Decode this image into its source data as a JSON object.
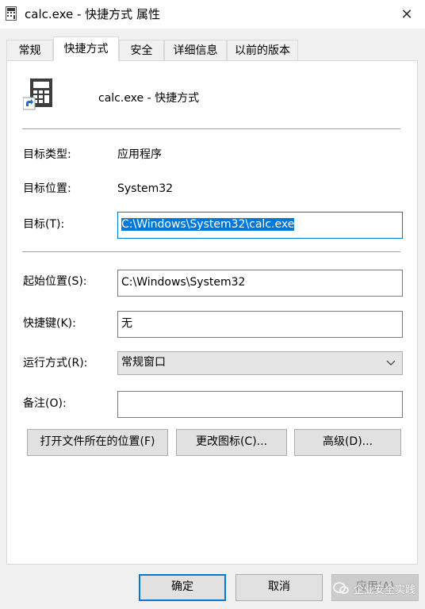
{
  "window": {
    "title": "calc.exe - 快捷方式 属性",
    "close_glyph": "✕"
  },
  "tabs": [
    {
      "label": "常规"
    },
    {
      "label": "快捷方式"
    },
    {
      "label": "安全"
    },
    {
      "label": "详细信息"
    },
    {
      "label": "以前的版本"
    }
  ],
  "shortcut": {
    "name": "calc.exe - 快捷方式",
    "icon": "calculator-shortcut-icon",
    "target_type_label": "目标类型:",
    "target_type_value": "应用程序",
    "target_location_label": "目标位置:",
    "target_location_value": "System32",
    "target_label": "目标(T):",
    "target_value": "C:\\Windows\\System32\\calc.exe",
    "start_in_label": "起始位置(S):",
    "start_in_value": "C:\\Windows\\System32",
    "hotkey_label": "快捷键(K):",
    "hotkey_value": "无",
    "run_label": "运行方式(R):",
    "run_value": "常规窗口",
    "comment_label": "备注(O):",
    "comment_value": ""
  },
  "actions": {
    "open_location": "打开文件所在的位置(F)",
    "change_icon": "更改图标(C)...",
    "advanced": "高级(D)..."
  },
  "footer": {
    "ok": "确定",
    "cancel": "取消",
    "apply": "应用(A)"
  },
  "watermark": {
    "text": "企业安全实践"
  },
  "colors": {
    "accent": "#0078d7",
    "selection_bg": "#0078d7"
  }
}
